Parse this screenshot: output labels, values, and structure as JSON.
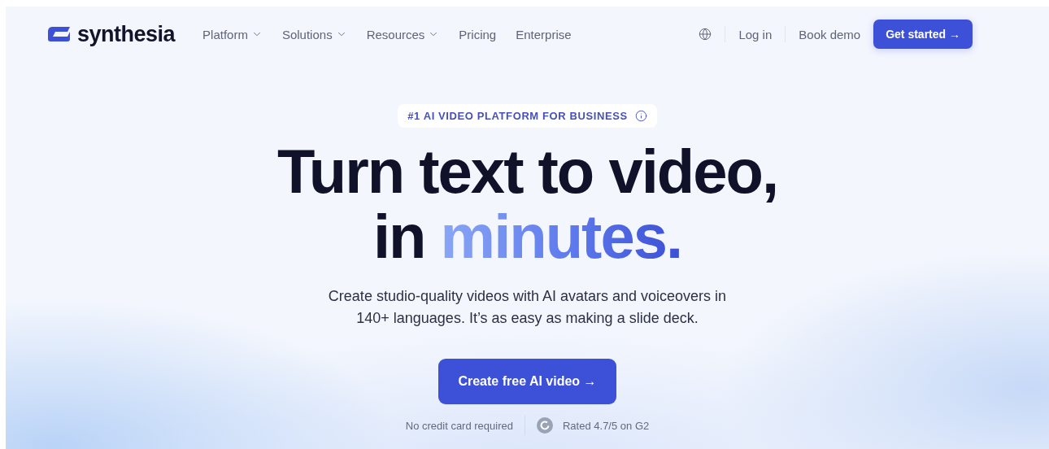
{
  "nav": {
    "logo": "synthesia",
    "menu": [
      {
        "label": "Platform",
        "has_dropdown": true
      },
      {
        "label": "Solutions",
        "has_dropdown": true
      },
      {
        "label": "Resources",
        "has_dropdown": true
      },
      {
        "label": "Pricing",
        "has_dropdown": false
      },
      {
        "label": "Enterprise",
        "has_dropdown": false
      }
    ],
    "login": "Log in",
    "book_demo": "Book demo",
    "cta": "Get started →"
  },
  "hero": {
    "badge": "#1 AI VIDEO PLATFORM FOR BUSINESS",
    "headline_line1": "Turn text to video,",
    "headline_line2_plain": "in",
    "headline_line2_accent": "minutes.",
    "subtitle_line1": "Create studio-quality videos with AI avatars and voiceovers in",
    "subtitle_line2": "140+ languages. It’s as easy as making a slide deck.",
    "cta": "Create free AI video →",
    "note": "No credit card required",
    "rating": "Rated 4.7/5 on G2"
  }
}
